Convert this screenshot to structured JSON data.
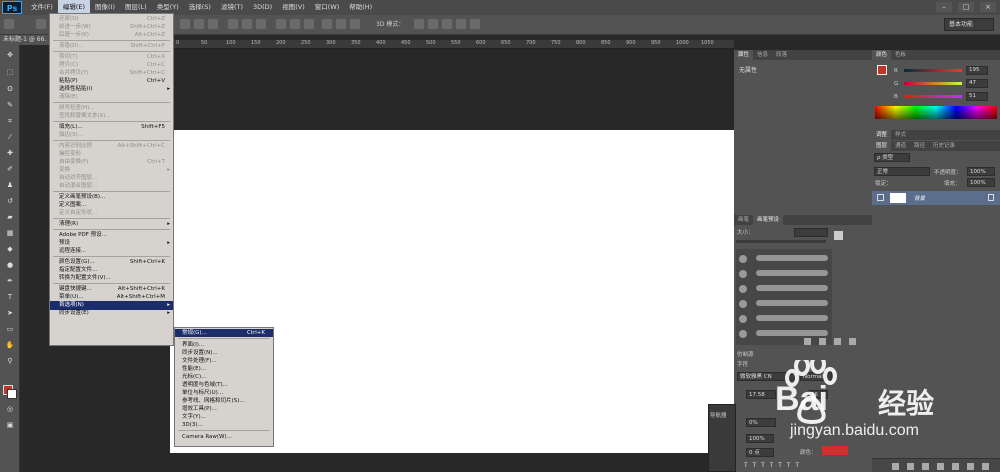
{
  "app": {
    "logo": "Ps"
  },
  "menubar": {
    "items": [
      {
        "label": "文件(F)"
      },
      {
        "label": "编辑(E)",
        "active": true
      },
      {
        "label": "图像(I)"
      },
      {
        "label": "图层(L)"
      },
      {
        "label": "类型(Y)"
      },
      {
        "label": "选择(S)"
      },
      {
        "label": "滤镜(T)"
      },
      {
        "label": "3D(D)"
      },
      {
        "label": "视图(V)"
      },
      {
        "label": "窗口(W)"
      },
      {
        "label": "帮助(H)"
      }
    ]
  },
  "window_controls": {
    "minimize": "–",
    "maximize": "□",
    "close": "×"
  },
  "options": {
    "mode_3d_label": "3D 模式：",
    "workspace_label": "基本功能"
  },
  "document": {
    "tab_label": "未标题-1 @ 66.",
    "ruler_labels": [
      "0",
      "50",
      "100",
      "150",
      "200",
      "250",
      "300",
      "350",
      "400",
      "450",
      "500",
      "550",
      "600",
      "650",
      "700",
      "750",
      "800",
      "850",
      "900",
      "950",
      "1000",
      "1050"
    ]
  },
  "edit_menu": {
    "items": [
      {
        "label": "还原(O)",
        "shortcut": "Ctrl+Z",
        "disabled": true
      },
      {
        "label": "前进一步(W)",
        "shortcut": "Shift+Ctrl+Z",
        "disabled": true
      },
      {
        "label": "后退一步(K)",
        "shortcut": "Alt+Ctrl+Z",
        "disabled": true
      },
      {
        "sep": true
      },
      {
        "label": "渐隐(D)...",
        "shortcut": "Shift+Ctrl+F",
        "disabled": true
      },
      {
        "sep": true
      },
      {
        "label": "剪切(T)",
        "shortcut": "Ctrl+X",
        "disabled": true
      },
      {
        "label": "拷贝(C)",
        "shortcut": "Ctrl+C",
        "disabled": true
      },
      {
        "label": "合并拷贝(Y)",
        "shortcut": "Shift+Ctrl+C",
        "disabled": true
      },
      {
        "label": "粘贴(P)",
        "shortcut": "Ctrl+V"
      },
      {
        "label": "选择性粘贴(I)",
        "submenu": true
      },
      {
        "label": "清除(E)",
        "disabled": true
      },
      {
        "sep": true
      },
      {
        "label": "拼写检查(H)...",
        "disabled": true
      },
      {
        "label": "查找和替换文本(X)...",
        "disabled": true
      },
      {
        "sep": true
      },
      {
        "label": "填充(L)...",
        "shortcut": "Shift+F5"
      },
      {
        "label": "描边(S)...",
        "disabled": true
      },
      {
        "sep": true
      },
      {
        "label": "内容识别比例",
        "shortcut": "Alt+Shift+Ctrl+C",
        "disabled": true
      },
      {
        "label": "操控变形",
        "disabled": true
      },
      {
        "label": "自由变换(F)",
        "shortcut": "Ctrl+T",
        "disabled": true
      },
      {
        "label": "变换",
        "submenu": true,
        "disabled": true
      },
      {
        "label": "自动对齐图层...",
        "disabled": true
      },
      {
        "label": "自动混合图层...",
        "disabled": true
      },
      {
        "sep": true
      },
      {
        "label": "定义画笔预设(B)..."
      },
      {
        "label": "定义图案..."
      },
      {
        "label": "定义自定形状...",
        "disabled": true
      },
      {
        "sep": true
      },
      {
        "label": "清理(R)",
        "submenu": true
      },
      {
        "sep": true
      },
      {
        "label": "Adobe PDF 预设..."
      },
      {
        "label": "预设",
        "submenu": true
      },
      {
        "label": "远程连接..."
      },
      {
        "sep": true
      },
      {
        "label": "颜色设置(G)...",
        "shortcut": "Shift+Ctrl+K"
      },
      {
        "label": "指定配置文件..."
      },
      {
        "label": "转换为配置文件(V)..."
      },
      {
        "sep": true
      },
      {
        "label": "键盘快捷键...",
        "shortcut": "Alt+Shift+Ctrl+K"
      },
      {
        "label": "菜单(U)...",
        "shortcut": "Alt+Shift+Ctrl+M"
      },
      {
        "label": "首选项(N)",
        "submenu": true,
        "highlight": true
      },
      {
        "label": "同步设置(E)",
        "submenu": true
      }
    ]
  },
  "preferences_submenu": {
    "items": [
      {
        "label": "常规(G)...",
        "shortcut": "Ctrl+K",
        "highlight": true
      },
      {
        "sep": true
      },
      {
        "label": "界面(I)..."
      },
      {
        "label": "同步设置(N)..."
      },
      {
        "label": "文件处理(F)..."
      },
      {
        "label": "性能(E)..."
      },
      {
        "label": "光标(C)..."
      },
      {
        "label": "透明度与色域(T)..."
      },
      {
        "label": "单位与标尺(U)..."
      },
      {
        "label": "参考线、网格和切片(S)..."
      },
      {
        "label": "增效工具(P)..."
      },
      {
        "label": "文字(Y)..."
      },
      {
        "label": "3D(3)..."
      },
      {
        "sep": true
      },
      {
        "label": "Camera Raw(W)..."
      }
    ]
  },
  "properties_panel": {
    "tabs": [
      "属性",
      "信息",
      "段落"
    ],
    "content": "无属性"
  },
  "brush_panel": {
    "tabs": [
      "画笔",
      "画笔预设"
    ],
    "size_label": "大小："
  },
  "char_panel": {
    "header1": "仿制源",
    "header2": "字符",
    "font": "微软雅黑 CN",
    "style": "Normal",
    "size": "17.58",
    "leading": "36",
    "tracking": "0%",
    "scale": "100%",
    "baseline": "0 点",
    "color_label": "颜色：",
    "color_swatch": "#d42f2f"
  },
  "color_panel": {
    "tabs": [
      "颜色",
      "色板"
    ],
    "r_label": "R",
    "g_label": "G",
    "b_label": "B",
    "r": "195",
    "g": "47",
    "b": "51",
    "fg_color": "#c1352a"
  },
  "adjust_panel": {
    "tabs": [
      "调整",
      "样式"
    ]
  },
  "layers_panel": {
    "tabs": [
      "图层",
      "通道",
      "路径",
      "历史记录"
    ],
    "kind": "ρ 类型",
    "blend": "正常",
    "opacity_label": "不透明度：",
    "opacity": "100%",
    "lock_label": "锁定：",
    "fill_label": "填充：",
    "fill": "100%",
    "layer_name": "背景"
  },
  "navigator": {
    "label": "导航器"
  },
  "watermark": {
    "brand": "Bai",
    "brand2": "经验",
    "url": "jingyan.baidu.com"
  }
}
